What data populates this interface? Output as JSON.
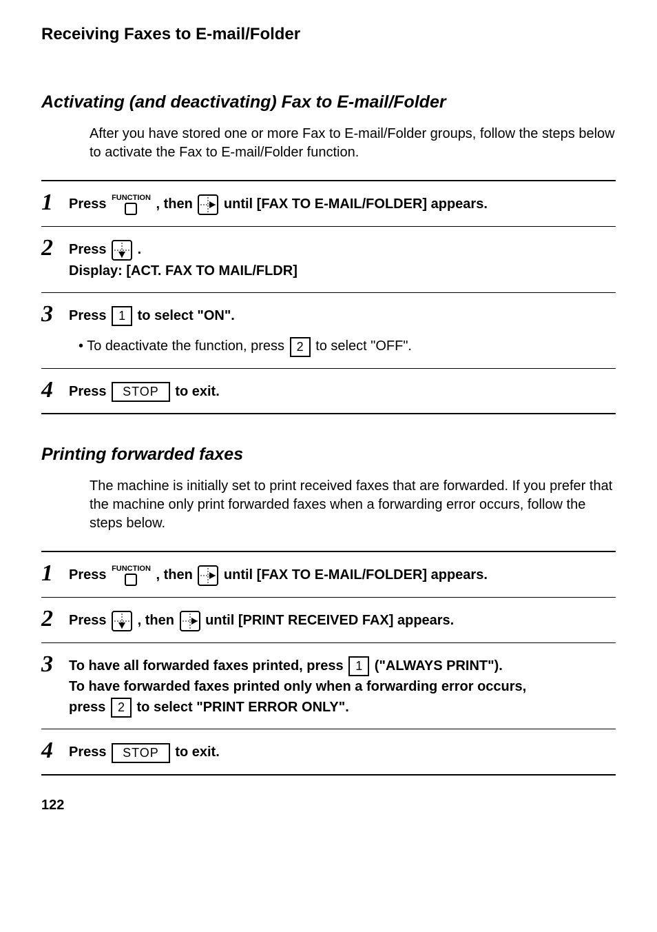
{
  "running_head": "Receiving Faxes to E-mail/Folder",
  "sectionA": {
    "title": "Activating (and deactivating) Fax to E-mail/Folder",
    "intro": "After you have stored one or more Fax to E-mail/Folder groups, follow the steps below to activate the Fax to E-mail/Folder function.",
    "steps": [
      {
        "num": "1",
        "pre": "Press ",
        "mid": ", then ",
        "post": " until [FAX TO E-MAIL/FOLDER] appears."
      },
      {
        "num": "2",
        "pre": "Press ",
        "post": ".",
        "line2": "Display: [ACT. FAX TO MAIL/FLDR]"
      },
      {
        "num": "3",
        "pre": "Press ",
        "key1": "1",
        "post": " to select \"ON\".",
        "bullet_pre": "To deactivate the function, press ",
        "bullet_key": "2",
        "bullet_post": " to select \"OFF\"."
      },
      {
        "num": "4",
        "pre": "Press ",
        "key": "STOP",
        "post": " to exit."
      }
    ]
  },
  "sectionB": {
    "title": "Printing forwarded faxes",
    "intro": "The machine is initially set to print received faxes that are forwarded. If you prefer that the machine only print forwarded faxes when a forwarding error occurs, follow the steps below.",
    "steps": [
      {
        "num": "1",
        "pre": "Press ",
        "mid": ", then ",
        "post": " until [FAX TO E-MAIL/FOLDER] appears."
      },
      {
        "num": "2",
        "pre": "Press ",
        "mid": ", then ",
        "post": " until [PRINT RECEIVED FAX] appears."
      },
      {
        "num": "3",
        "l1_pre": "To have all forwarded faxes printed, press ",
        "l1_key": "1",
        "l1_post": " (\"ALWAYS PRINT\").",
        "l2": "To have forwarded faxes printed only when a forwarding error occurs,",
        "l3_pre": "press ",
        "l3_key": "2",
        "l3_post": " to select \"PRINT ERROR ONLY\"."
      },
      {
        "num": "4",
        "pre": "Press ",
        "key": "STOP",
        "post": " to exit."
      }
    ]
  },
  "function_label": "FUNCTION",
  "page_number": "122"
}
